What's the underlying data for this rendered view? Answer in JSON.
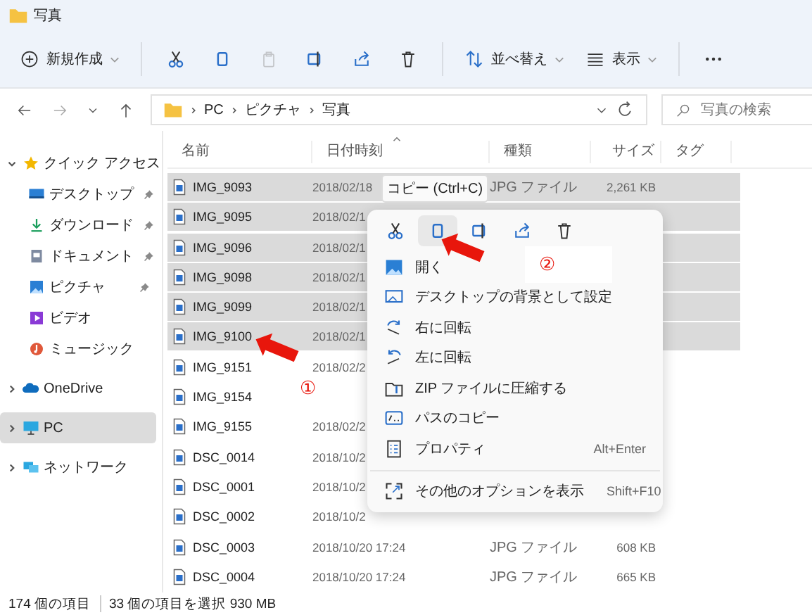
{
  "window": {
    "title": "写真"
  },
  "toolbar": [
    {
      "kind": "new",
      "label": "新規作成",
      "disabled": false
    },
    {
      "kind": "cut",
      "disabled": false
    },
    {
      "kind": "copy",
      "disabled": false
    },
    {
      "kind": "paste",
      "disabled": true
    },
    {
      "kind": "rename",
      "disabled": false
    },
    {
      "kind": "share",
      "disabled": false
    },
    {
      "kind": "delete",
      "disabled": false
    },
    {
      "kind": "sort",
      "label": "並べ替え",
      "disabled": false
    },
    {
      "kind": "view",
      "label": "表示",
      "disabled": false
    },
    {
      "kind": "more",
      "disabled": false
    }
  ],
  "address": {
    "path": [
      "PC",
      "ピクチャ",
      "写真"
    ],
    "search": {
      "placeholder": "写真の検索"
    }
  },
  "sidebar": {
    "items": [
      {
        "label": "クイック アクセス",
        "kind": "star",
        "expanded": true,
        "selected": false,
        "children": [
          {
            "label": "デスクトップ",
            "kind": "desktop",
            "pinned": true
          },
          {
            "label": "ダウンロード",
            "kind": "download",
            "pinned": true
          },
          {
            "label": "ドキュメント",
            "kind": "document",
            "pinned": true
          },
          {
            "label": "ピクチャ",
            "kind": "picture",
            "pinned": true
          },
          {
            "label": "ビデオ",
            "kind": "video",
            "pinned": false
          },
          {
            "label": "ミュージック",
            "kind": "music",
            "pinned": false
          }
        ]
      },
      {
        "label": "OneDrive",
        "kind": "cloud",
        "expanded": false,
        "selected": false
      },
      {
        "label": "PC",
        "kind": "pc",
        "expanded": false,
        "selected": true
      },
      {
        "label": "ネットワーク",
        "kind": "network",
        "expanded": false,
        "selected": false
      }
    ]
  },
  "table": {
    "columns": [
      "名前",
      "日付時刻",
      "種類",
      "サイズ",
      "タグ"
    ],
    "rows": [
      {
        "name": "IMG_9093",
        "date": "2018/02/18",
        "type": "JPG ファイル",
        "size": "2,261 KB",
        "selected": true
      },
      {
        "name": "IMG_9095",
        "date": "2018/02/1",
        "selected": true
      },
      {
        "name": "IMG_9096",
        "date": "2018/02/1",
        "selected": true
      },
      {
        "name": "IMG_9098",
        "date": "2018/02/1",
        "selected": true
      },
      {
        "name": "IMG_9099",
        "date": "2018/02/1",
        "selected": true
      },
      {
        "name": "IMG_9100",
        "date": "2018/02/1",
        "selected": true
      },
      {
        "name": "IMG_9151",
        "date": "2018/02/2",
        "selected": false
      },
      {
        "name": "IMG_9154",
        "selected": false
      },
      {
        "name": "IMG_9155",
        "date": "2018/02/2",
        "selected": false
      },
      {
        "name": "DSC_0014",
        "date": "2018/10/2",
        "selected": false
      },
      {
        "name": "DSC_0001",
        "date": "2018/10/2",
        "selected": false
      },
      {
        "name": "DSC_0002",
        "date": "2018/10/2",
        "selected": false
      },
      {
        "name": "DSC_0003",
        "date": "2018/10/20 17:24",
        "type": "JPG ファイル",
        "size": "608 KB",
        "selected": false
      },
      {
        "name": "DSC_0004",
        "date": "2018/10/20 17:24",
        "type": "JPG ファイル",
        "size": "665 KB",
        "selected": false
      }
    ]
  },
  "context_menu": {
    "tooltip": "コピー (Ctrl+C)",
    "actions": [
      {
        "kind": "cut",
        "selected": false
      },
      {
        "kind": "copy",
        "selected": true
      },
      {
        "kind": "rename",
        "selected": false
      },
      {
        "kind": "share",
        "selected": false
      },
      {
        "kind": "delete",
        "selected": false
      }
    ],
    "items": [
      {
        "kind": "open",
        "label": "開く"
      },
      {
        "kind": "wallpaper",
        "label": "デスクトップの背景として設定"
      },
      {
        "kind": "rotate-right",
        "label": "右に回転"
      },
      {
        "kind": "rotate-left",
        "label": "左に回転"
      },
      {
        "kind": "zip",
        "label": "ZIP ファイルに圧縮する"
      },
      {
        "kind": "path",
        "label": "パスのコピー"
      },
      {
        "kind": "properties",
        "label": "プロパティ",
        "shortcut": "Alt+Enter"
      },
      {
        "kind": "more",
        "label": "その他のオプションを表示",
        "shortcut": "Shift+F10",
        "separated": true
      }
    ]
  },
  "annotations": [
    {
      "label": "①"
    },
    {
      "label": "②"
    }
  ],
  "status_bar": {
    "count": "174 個の項目",
    "selection": "33 個の項目を選択  930 MB"
  }
}
